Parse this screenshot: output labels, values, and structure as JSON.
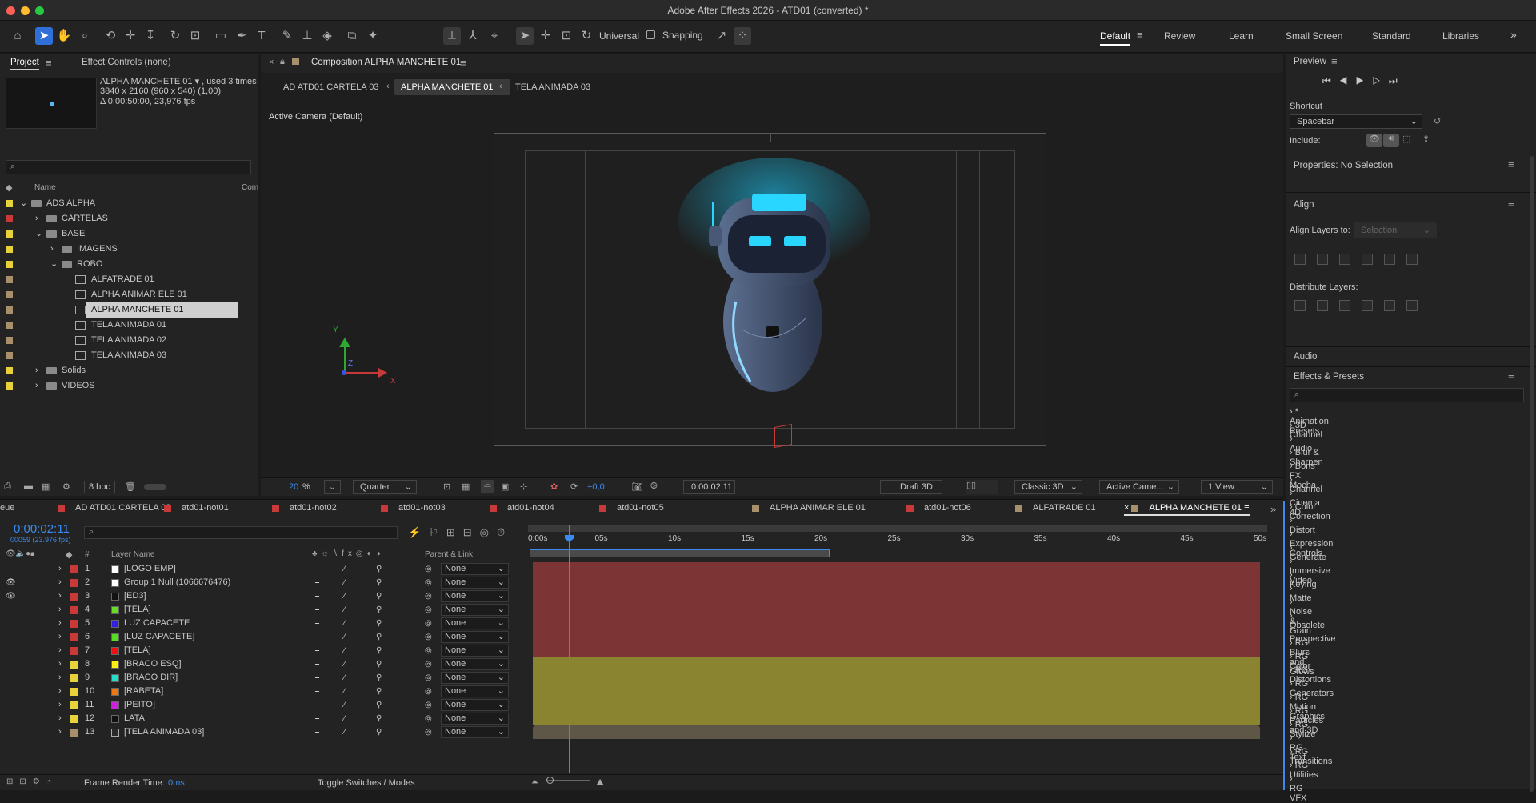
{
  "window": {
    "title": "Adobe After Effects 2026 - ATD01 (converted) *"
  },
  "toolbar": {
    "axis_mode": "Universal",
    "snapping": "Snapping"
  },
  "workspaces": [
    "Default",
    "Review",
    "Learn",
    "Small Screen",
    "Standard",
    "Libraries"
  ],
  "project": {
    "tab_project": "Project",
    "tab_effect_controls": "Effect Controls (none)",
    "item_name": "ALPHA MANCHETE 01 ▾ , used 3 times",
    "item_res": "3840 x 2160  (960 x 540) (1,00)",
    "item_dur": "Δ 0:00:50:00, 23,976 fps",
    "col_name": "Name",
    "col_com": "Com",
    "tree": [
      {
        "name": "ADS ALPHA",
        "level": 0,
        "type": "folder",
        "open": true,
        "color": "#e8d23c"
      },
      {
        "name": "CARTELAS",
        "level": 1,
        "type": "folder",
        "open": false,
        "color": "#c83a3a"
      },
      {
        "name": "BASE",
        "level": 1,
        "type": "folder",
        "open": true,
        "color": "#e8d23c"
      },
      {
        "name": "IMAGENS",
        "level": 2,
        "type": "folder",
        "open": false,
        "color": "#e8d23c"
      },
      {
        "name": "ROBO",
        "level": 2,
        "type": "folder",
        "open": true,
        "color": "#e8d23c"
      },
      {
        "name": "ALFATRADE 01",
        "level": 3,
        "type": "comp",
        "color": "#a8906c"
      },
      {
        "name": "ALPHA ANIMAR ELE 01",
        "level": 3,
        "type": "comp",
        "color": "#a8906c"
      },
      {
        "name": "ALPHA MANCHETE 01",
        "level": 3,
        "type": "comp",
        "color": "#a8906c",
        "selected": true
      },
      {
        "name": "TELA ANIMADA 01",
        "level": 3,
        "type": "comp",
        "color": "#a8906c"
      },
      {
        "name": "TELA ANIMADA 02",
        "level": 3,
        "type": "comp",
        "color": "#a8906c"
      },
      {
        "name": "TELA ANIMADA 03",
        "level": 3,
        "type": "comp",
        "color": "#a8906c"
      },
      {
        "name": "Solids",
        "level": 1,
        "type": "folder",
        "open": false,
        "color": "#e8d23c"
      },
      {
        "name": "VIDEOS",
        "level": 1,
        "type": "folder",
        "open": false,
        "color": "#e8d23c"
      }
    ],
    "bpc": "8 bpc"
  },
  "composition": {
    "panel_title": "Composition ALPHA MANCHETE 01",
    "breadcrumbs": [
      "AD ATD01 CARTELA 03",
      "ALPHA MANCHETE 01",
      "TELA ANIMADA 03"
    ],
    "camera_label": "Active Camera (Default)",
    "zoom": "20",
    "zoom_unit": "%",
    "resolution": "Quarter",
    "exposure": "+0,0",
    "timecode": "0:00:02:11",
    "draft3d": "Draft 3D",
    "renderer": "Classic 3D",
    "camera": "Active Came...",
    "views": "1 View",
    "axis_x": "X",
    "axis_y": "Y",
    "axis_z": "Z"
  },
  "timeline": {
    "tabs": [
      {
        "name": "eue",
        "color": ""
      },
      {
        "name": "AD ATD01 CARTELA 03",
        "color": "#c83a3a"
      },
      {
        "name": "atd01-not01",
        "color": "#c83a3a"
      },
      {
        "name": "atd01-not02",
        "color": "#c83a3a"
      },
      {
        "name": "atd01-not03",
        "color": "#c83a3a"
      },
      {
        "name": "atd01-not04",
        "color": "#c83a3a"
      },
      {
        "name": "atd01-not05",
        "color": "#c83a3a"
      },
      {
        "name": "ALPHA ANIMAR ELE 01",
        "color": "#a8906c"
      },
      {
        "name": "atd01-not06",
        "color": "#c83a3a"
      },
      {
        "name": "ALFATRADE 01",
        "color": "#a8906c"
      },
      {
        "name": "ALPHA MANCHETE 01",
        "color": "#a8906c",
        "active": true
      }
    ],
    "timecode": "0:00:02:11",
    "frame_info": "00059 (23.976 fps)",
    "col_layer_name": "Layer Name",
    "col_parent": "Parent & Link",
    "col_num": "#",
    "ruler": [
      "0:00s",
      "05s",
      "10s",
      "15s",
      "20s",
      "25s",
      "30s",
      "35s",
      "40s",
      "45s",
      "50s"
    ],
    "playhead_seconds": 2.46,
    "work_area_end_seconds": 20.5,
    "duration_seconds": 50,
    "layers": [
      {
        "num": "1",
        "name": "[LOGO EMP]",
        "color": "#ffffff",
        "label": "#c83a3a",
        "eye": false,
        "bar": "red"
      },
      {
        "num": "2",
        "name": "Group 1 Null (1066676476)",
        "color": "#ffffff",
        "label": "#c83a3a",
        "eye": true,
        "bar": "red"
      },
      {
        "num": "3",
        "name": "[ED3]",
        "color": "#111111",
        "label": "#c83a3a",
        "eye": true,
        "bar": "red"
      },
      {
        "num": "4",
        "name": "[TELA]",
        "color": "#66dd22",
        "label": "#c83a3a",
        "eye": false,
        "bar": "red"
      },
      {
        "num": "5",
        "name": "LUZ CAPACETE",
        "color": "#3322dd",
        "label": "#c83a3a",
        "eye": false,
        "bar": "red"
      },
      {
        "num": "6",
        "name": "[LUZ CAPACETE]",
        "color": "#55dd22",
        "label": "#c83a3a",
        "eye": false,
        "bar": "red"
      },
      {
        "num": "7",
        "name": "[TELA]",
        "color": "#ee1111",
        "label": "#c83a3a",
        "eye": false,
        "bar": "red"
      },
      {
        "num": "8",
        "name": "[BRACO ESQ]",
        "color": "#ffee11",
        "label": "#e8d23c",
        "eye": false,
        "bar": "yellow"
      },
      {
        "num": "9",
        "name": "[BRACO DIR]",
        "color": "#22ddcc",
        "label": "#e8d23c",
        "eye": false,
        "bar": "yellow"
      },
      {
        "num": "10",
        "name": "[RABETA]",
        "color": "#ee7711",
        "label": "#e8d23c",
        "eye": false,
        "bar": "yellow"
      },
      {
        "num": "11",
        "name": "[PEITO]",
        "color": "#cc22dd",
        "label": "#e8d23c",
        "eye": false,
        "bar": "yellow"
      },
      {
        "num": "12",
        "name": "LATA",
        "color": "#111111",
        "label": "#e8d23c",
        "eye": false,
        "bar": "yellow"
      },
      {
        "num": "13",
        "name": "[TELA ANIMADA 03]",
        "color": "comp",
        "label": "#a8906c",
        "eye": false,
        "bar": "tan"
      }
    ],
    "parent_value": "None",
    "frame_render_label": "Frame Render Time:",
    "frame_render_value": "0ms",
    "toggle_label": "Toggle Switches / Modes"
  },
  "preview": {
    "title": "Preview",
    "shortcut_label": "Shortcut",
    "shortcut_value": "Spacebar",
    "include_label": "Include:"
  },
  "properties": {
    "title": "Properties: No Selection"
  },
  "align": {
    "title": "Align",
    "align_to_label": "Align Layers to:",
    "align_to_value": "Selection",
    "distribute_label": "Distribute Layers:"
  },
  "audio": {
    "title": "Audio"
  },
  "effects": {
    "title": "Effects & Presets",
    "items": [
      "* Animation Presets",
      "3D Channel",
      "Audio",
      "Blur & Sharpen",
      "Boris FX Mocha",
      "Channel",
      "Cinema 4D",
      "Color Correction",
      "Distort",
      "Expression Controls",
      "Generate",
      "Immersive Video",
      "Keying",
      "Matte",
      "Noise & Grain",
      "Obsolete",
      "Perspective",
      "RG Blurs and Glows",
      "RG Color",
      "RG Distortions",
      "RG Generators",
      "RG Motion Graphics",
      "RG Particles and 3D",
      "RG Stylize",
      "RG Text",
      "RG Transitions",
      "RG Utilities",
      "RG VFX"
    ]
  }
}
